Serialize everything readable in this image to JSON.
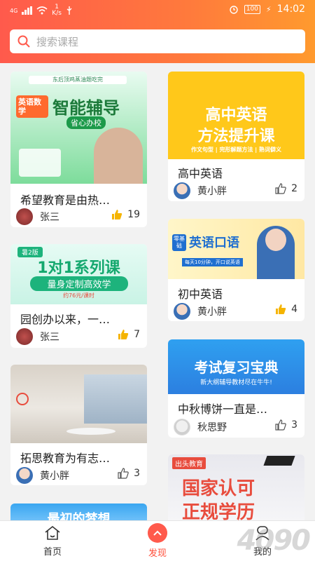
{
  "status_bar": {
    "network": "4G",
    "speed_value": "1",
    "speed_unit": "K/s",
    "battery": "100",
    "time": "14:02"
  },
  "search": {
    "placeholder": "搜索课程"
  },
  "colors": {
    "accent": "#ff5a4c",
    "accent_end": "#ff9a2e",
    "like_yellow": "#f5b400"
  },
  "cards": [
    {
      "title": "希望教育是由热…",
      "author": "张三",
      "likes": "19",
      "liked": true,
      "thumb": {
        "main": "智能辅导",
        "badge": "英语数学",
        "sub": "省心办校",
        "top": "东后顶鸡蒸油题吃完"
      }
    },
    {
      "title": "高中英语",
      "author": "黄小胖",
      "likes": "2",
      "liked": false,
      "thumb": {
        "line1": "高中英语",
        "line2": "方法提升课",
        "sub": "作文句型 | 完形解题方法 | 熟词僻义"
      }
    },
    {
      "title": "初中英语",
      "author": "黄小胖",
      "likes": "4",
      "liked": true,
      "thumb": {
        "main": "英语口语",
        "tag": "零基础",
        "sub": "每天10分钟，开口说英语"
      }
    },
    {
      "title": "园创办以来，一…",
      "author": "张三",
      "likes": "7",
      "liked": true,
      "thumb": {
        "badge": "暑2版",
        "main": "1对1系列课",
        "sub": "量身定制高效学",
        "price": "约76元/课时"
      }
    },
    {
      "title": "中秋博饼一直是…",
      "author": "秋思野",
      "likes": "3",
      "liked": false,
      "thumb": {
        "main": "考试复习宝典",
        "sub": "新大纲辅导教材尽在牛牛!"
      }
    },
    {
      "title": "拓思教育为有志…",
      "author": "黄小胖",
      "likes": "3",
      "liked": false,
      "thumb": {}
    },
    {
      "title": "",
      "author": "",
      "likes": "",
      "liked": false,
      "thumb": {
        "brand": "出头教育",
        "line1": "国家认可",
        "line2": "正规学历"
      }
    },
    {
      "title": "",
      "author": "",
      "likes": "",
      "liked": false,
      "thumb": {
        "main": "最初的梦想"
      }
    }
  ],
  "tabbar": {
    "home": "首页",
    "discover": "发现",
    "mine": "我的"
  },
  "watermark": "4090"
}
